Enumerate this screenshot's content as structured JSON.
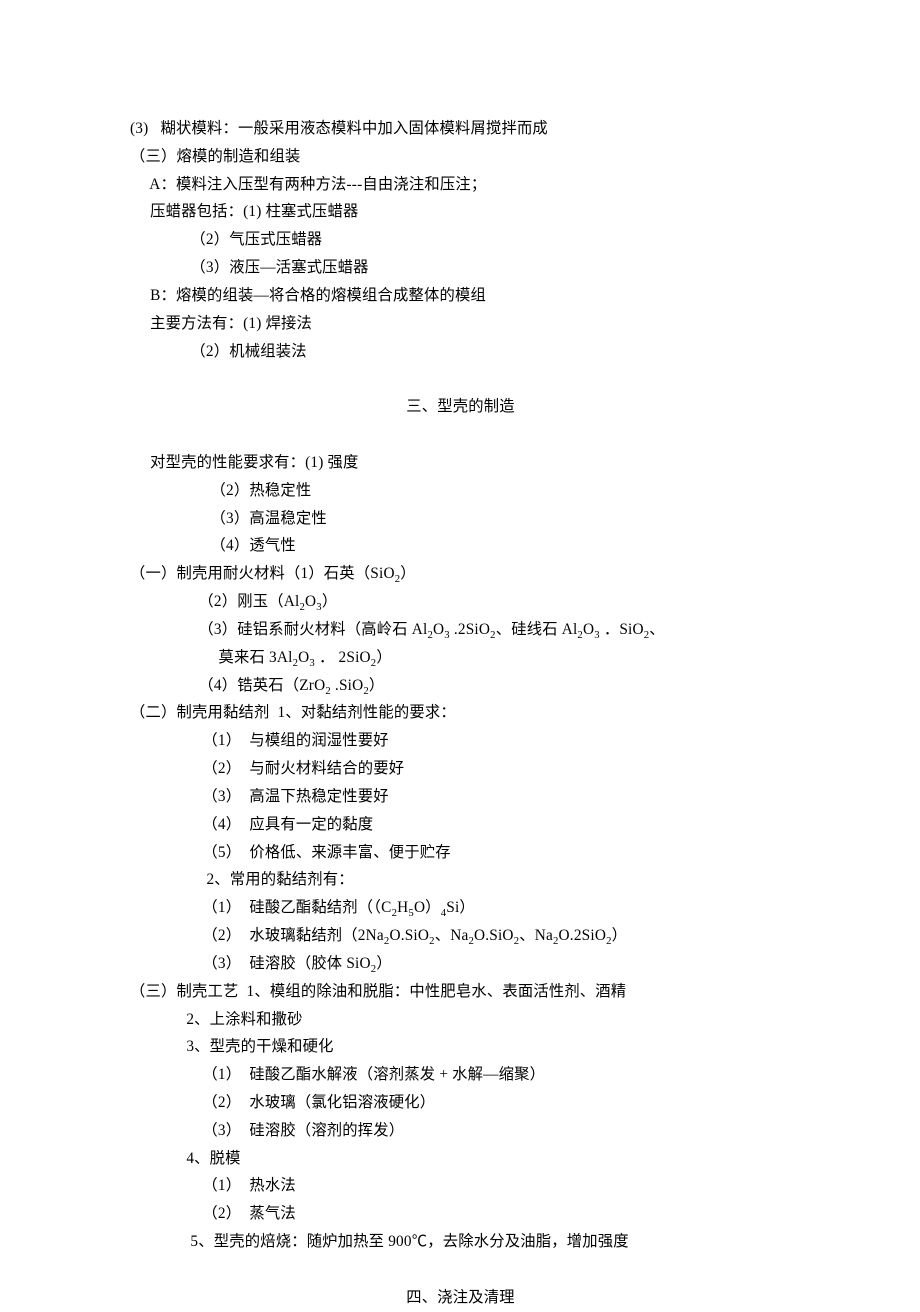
{
  "l01": "(3)   糊状模料：一般采用液态模料中加入固体模料屑搅拌而成",
  "l02": "（三）熔模的制造和组装",
  "l03": "     A：模料注入压型有两种方法---自由浇注和压注；",
  "l04": "     压蜡器包括：(1) 柱塞式压蜡器",
  "l05": "               （2）气压式压蜡器",
  "l06": "               （3）液压—活塞式压蜡器",
  "l07": "     B：熔模的组装—将合格的熔模组合成整体的模组",
  "l08": "     主要方法有：(1) 焊接法",
  "l09": "               （2）机械组装法",
  "h1": "三、型壳的制造",
  "l10": "     对型壳的性能要求有：(1) 强度",
  "l11": "                    （2）热稳定性",
  "l12": "                    （3）高温稳定性",
  "l13": "                    （4）透气性",
  "l14a": "（一）制壳用耐火材料（1）石英（SiO",
  "l14b": "）",
  "l15a": "                 （2）刚玉（Al",
  "l15b": "O",
  "l15c": "）",
  "l16a": "                 （3）硅铝系耐火材料（高岭石 Al",
  "l16b": "O",
  "l16c": " .2SiO",
  "l16d": "、硅线石 Al",
  "l16e": "O",
  "l16f": " ．SiO",
  "l16g": "、",
  "l17a": "                      莫来石 3Al",
  "l17b": "O",
  "l17c": " ． 2SiO",
  "l17d": "）",
  "l18a": "                 （4）锆英石（ZrO",
  "l18b": " .SiO",
  "l18c": "）",
  "l19": "（二）制壳用黏结剂  1、对黏结剂性能的要求：",
  "l20": "                  （1）  与模组的润湿性要好",
  "l21": "                  （2）  与耐火材料结合的要好",
  "l22": "                  （3）  高温下热稳定性要好",
  "l23": "                  （4）  应具有一定的黏度",
  "l24": "                  （5）  价格低、来源丰富、便于贮存",
  "l25": "                   2、常用的黏结剂有：",
  "l26a": "                  （1）  硅酸乙酯黏结剂（（C",
  "l26b": "H",
  "l26c": "O）",
  "l26d": "Si）",
  "l27a": "                  （2）  水玻璃黏结剂（2Na",
  "l27b": "O.SiO",
  "l27c": "、Na",
  "l27d": "O.SiO",
  "l27e": "、Na",
  "l27f": "O.2SiO",
  "l27g": "）",
  "l28a": "                  （3）  硅溶胶（胶体 SiO",
  "l28b": "）",
  "l29": "（三）制壳工艺  1、模组的除油和脱脂：中性肥皂水、表面活性剂、酒精",
  "l30": "              2、上涂料和撒砂",
  "l31": "              3、型壳的干燥和硬化",
  "l32": "                  （1）  硅酸乙酯水解液（溶剂蒸发 + 水解—缩聚）",
  "l33": "                  （2）  水玻璃（氯化铝溶液硬化）",
  "l34": "                  （3）  硅溶胶（溶剂的挥发）",
  "l35": "              4、脱模",
  "l36": "                  （1）  热水法",
  "l37": "                  （2）  蒸气法",
  "l38": "               5、型壳的焙烧：随炉加热至 900℃，去除水分及油脂，增加强度",
  "h2": "四、浇注及清理",
  "sub2": "2",
  "sub3": "3",
  "sub4": "4",
  "sub5": "5"
}
